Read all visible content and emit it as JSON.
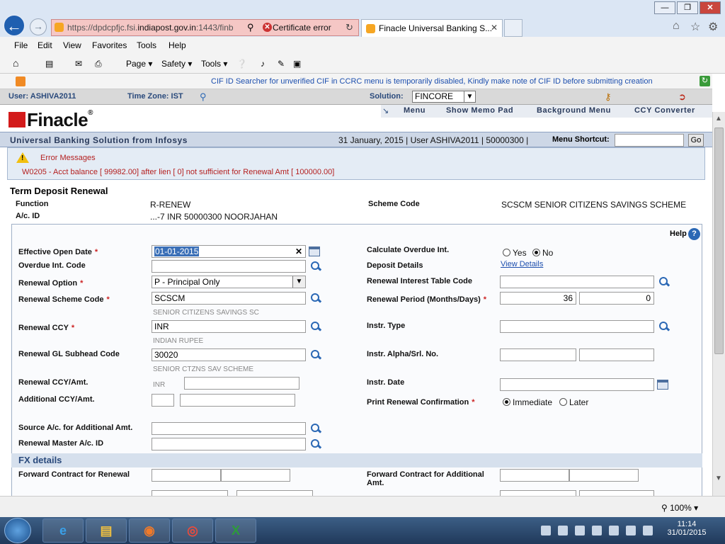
{
  "browser": {
    "url_prefix": "https://dpdcpfjc.fsi.",
    "url_domain": "indiapost.gov.in",
    "url_suffix": ":1443/finb",
    "cert_error": "Certificate error",
    "tab_title": "Finacle Universal Banking S...",
    "menu": [
      "File",
      "Edit",
      "View",
      "Favorites",
      "Tools",
      "Help"
    ],
    "cmd": {
      "page": "Page",
      "safety": "Safety",
      "tools": "Tools"
    }
  },
  "app": {
    "info_message": "CIF ID Searcher for unverified CIF in CCRC menu is temporarily disabled, Kindly make note of CIF ID before submitting creation",
    "user_label": "User: ASHIVA2011",
    "timezone_label": "Time Zone:  IST",
    "solution_label": "Solution:",
    "solution_value": "FINCORE",
    "logo": "Finacle",
    "top_menu": [
      "Menu",
      "Show Memo Pad",
      "Background Menu",
      "CCY Converter"
    ],
    "tagline": "Universal Banking Solution from Infosys",
    "date_info": "31 January, 2015  |  User  ASHIVA2011  |  50000300  |",
    "menu_shortcut": "Menu Shortcut:",
    "go": "Go"
  },
  "error": {
    "title": "Error Messages",
    "message": "W0205 - Acct balance [ 99982.00] after lien [ 0] not sufficient for Renewal Amt [ 100000.00]"
  },
  "form": {
    "title": "Term Deposit Renewal",
    "function_label": "Function",
    "function_value": "R-RENEW",
    "scheme_code_label": "Scheme Code",
    "scheme_code_value": "SCSCM SENIOR CITIZENS SAVINGS SCHEME",
    "acid_label": "A/c. ID",
    "acid_value": "...-7 INR 50000300 NOORJAHAN",
    "help": "Help",
    "fields": {
      "effective_open_date": {
        "label": "Effective Open Date",
        "value": "01-01-2015"
      },
      "overdue_int_code": {
        "label": "Overdue Int. Code",
        "value": ""
      },
      "renewal_option": {
        "label": "Renewal Option",
        "value": "P - Principal Only"
      },
      "renewal_scheme_code": {
        "label": "Renewal Scheme Code",
        "value": "SCSCM",
        "hint": "SENIOR CITIZENS SAVINGS SC"
      },
      "renewal_ccy": {
        "label": "Renewal CCY",
        "value": "INR",
        "hint": "INDIAN RUPEE"
      },
      "renewal_gl_subhead": {
        "label": "Renewal GL Subhead Code",
        "value": "30020",
        "hint": "SENIOR CTZNS SAV SCHEME"
      },
      "renewal_ccy_amt": {
        "label": "Renewal CCY/Amt.",
        "ccy": "INR",
        "value": ""
      },
      "additional_ccy_amt": {
        "label": "Additional CCY/Amt.",
        "value": ""
      },
      "source_ac": {
        "label": "Source A/c. for Additional Amt.",
        "value": ""
      },
      "renewal_master": {
        "label": "Renewal Master A/c. ID",
        "value": ""
      },
      "calc_overdue": {
        "label": "Calculate Overdue Int.",
        "yes": "Yes",
        "no": "No"
      },
      "deposit_details": {
        "label": "Deposit Details",
        "link": "View Details"
      },
      "renewal_interest_table": {
        "label": "Renewal Interest Table Code",
        "value": ""
      },
      "renewal_period": {
        "label": "Renewal Period (Months/Days)",
        "months": "36",
        "days": "0"
      },
      "instr_type": {
        "label": "Instr. Type",
        "value": ""
      },
      "instr_alpha": {
        "label": "Instr. Alpha/Srl. No.",
        "value": ""
      },
      "instr_date": {
        "label": "Instr. Date",
        "value": ""
      },
      "print_confirm": {
        "label": "Print Renewal Confirmation",
        "immediate": "Immediate",
        "later": "Later"
      }
    },
    "fx": {
      "title": "FX details",
      "fwd_renewal": "Forward Contract for Renewal",
      "fwd_additional": "Forward Contract for Additional Amt."
    }
  },
  "status": {
    "zoom": "100%"
  },
  "taskbar": {
    "time": "11:14",
    "date": "31/01/2015"
  }
}
